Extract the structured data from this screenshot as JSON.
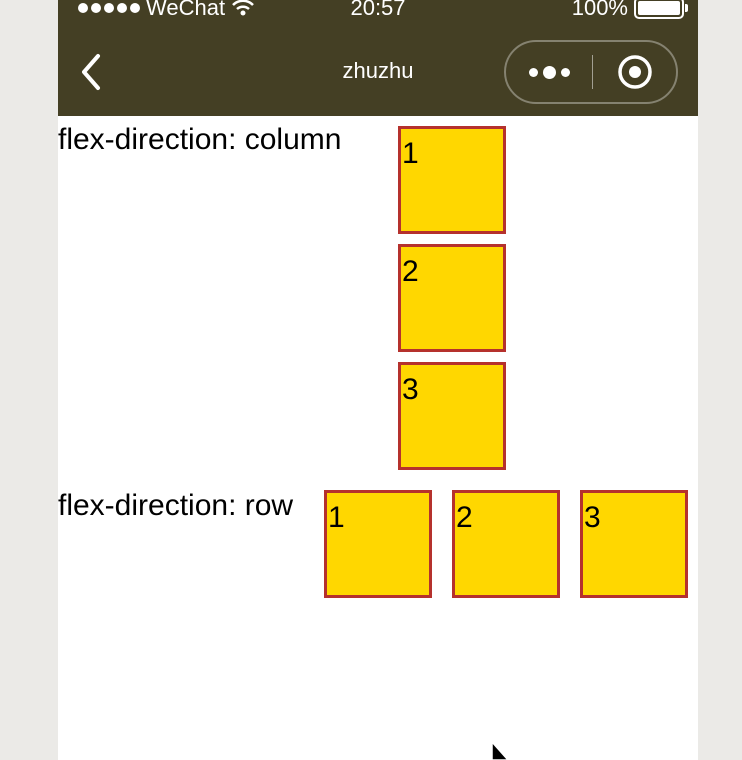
{
  "status_bar": {
    "carrier": "WeChat",
    "time": "20:57",
    "battery": "100%"
  },
  "nav_bar": {
    "title": "zhuzhu",
    "back_icon": "chevron-left-icon",
    "more_icon": "more-dots-icon",
    "close_icon": "target-circle-icon"
  },
  "sections": {
    "column": {
      "label": "flex-direction: column",
      "items": [
        "1",
        "2",
        "3"
      ]
    },
    "row": {
      "label": "flex-direction: row",
      "items": [
        "1",
        "2",
        "3"
      ]
    }
  },
  "colors": {
    "nav_background": "#443f24",
    "box_fill": "#ffd700",
    "box_border": "#b5312d",
    "outer_background": "#ebeae7"
  }
}
